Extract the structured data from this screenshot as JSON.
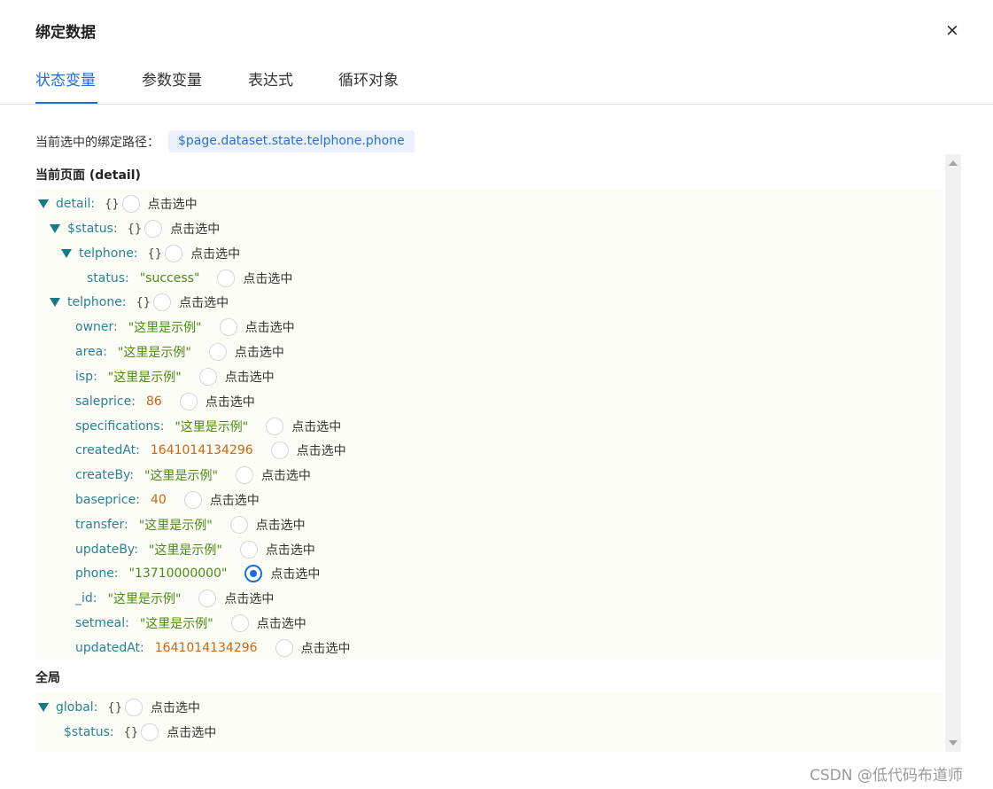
{
  "dialog": {
    "title": "绑定数据",
    "close_symbol": "×"
  },
  "tabs": [
    {
      "label": "状态变量",
      "active": true
    },
    {
      "label": "参数变量",
      "active": false
    },
    {
      "label": "表达式",
      "active": false
    },
    {
      "label": "循环对象",
      "active": false
    }
  ],
  "binding_path": {
    "label": "当前选中的绑定路径：",
    "value": "$page.dataset.state.telphone.phone"
  },
  "select_text": "点击选中",
  "sections": {
    "page": {
      "title": "当前页面 (detail)"
    },
    "global": {
      "title": "全局"
    }
  },
  "tree": {
    "detail": {
      "key": "detail:",
      "brace": "{}"
    },
    "status_group": {
      "key": "$status:",
      "brace": "{}"
    },
    "status_telphone": {
      "key": "telphone:",
      "brace": "{}"
    },
    "status_status": {
      "key": "status:",
      "value": "\"success\""
    },
    "telphone": {
      "key": "telphone:",
      "brace": "{}"
    },
    "fields": [
      {
        "key": "owner:",
        "value": "\"这里是示例\"",
        "type": "string",
        "selected": false
      },
      {
        "key": "area:",
        "value": "\"这里是示例\"",
        "type": "string",
        "selected": false
      },
      {
        "key": "isp:",
        "value": "\"这里是示例\"",
        "type": "string",
        "selected": false
      },
      {
        "key": "saleprice:",
        "value": "86",
        "type": "number",
        "selected": false
      },
      {
        "key": "specifications:",
        "value": "\"这里是示例\"",
        "type": "string",
        "selected": false
      },
      {
        "key": "createdAt:",
        "value": "1641014134296",
        "type": "number",
        "selected": false
      },
      {
        "key": "createBy:",
        "value": "\"这里是示例\"",
        "type": "string",
        "selected": false
      },
      {
        "key": "baseprice:",
        "value": "40",
        "type": "number",
        "selected": false
      },
      {
        "key": "transfer:",
        "value": "\"这里是示例\"",
        "type": "string",
        "selected": false
      },
      {
        "key": "updateBy:",
        "value": "\"这里是示例\"",
        "type": "string",
        "selected": false
      },
      {
        "key": "phone:",
        "value": "\"13710000000\"",
        "type": "string",
        "selected": true
      },
      {
        "key": "_id:",
        "value": "\"这里是示例\"",
        "type": "string",
        "selected": false
      },
      {
        "key": "setmeal:",
        "value": "\"这里是示例\"",
        "type": "string",
        "selected": false
      },
      {
        "key": "updatedAt:",
        "value": "1641014134296",
        "type": "number",
        "selected": false
      }
    ],
    "global": {
      "key": "global:",
      "brace": "{}"
    },
    "global_status": {
      "key": "$status:",
      "brace": "{}"
    }
  },
  "watermark": "CSDN @低代码布道师",
  "colors": {
    "accent": "#1a6fd6",
    "key": "#2a8196",
    "string": "#4c8b12",
    "number": "#d2650f",
    "toggle": "#137a86",
    "tree_bg": "#fcfdf7"
  }
}
